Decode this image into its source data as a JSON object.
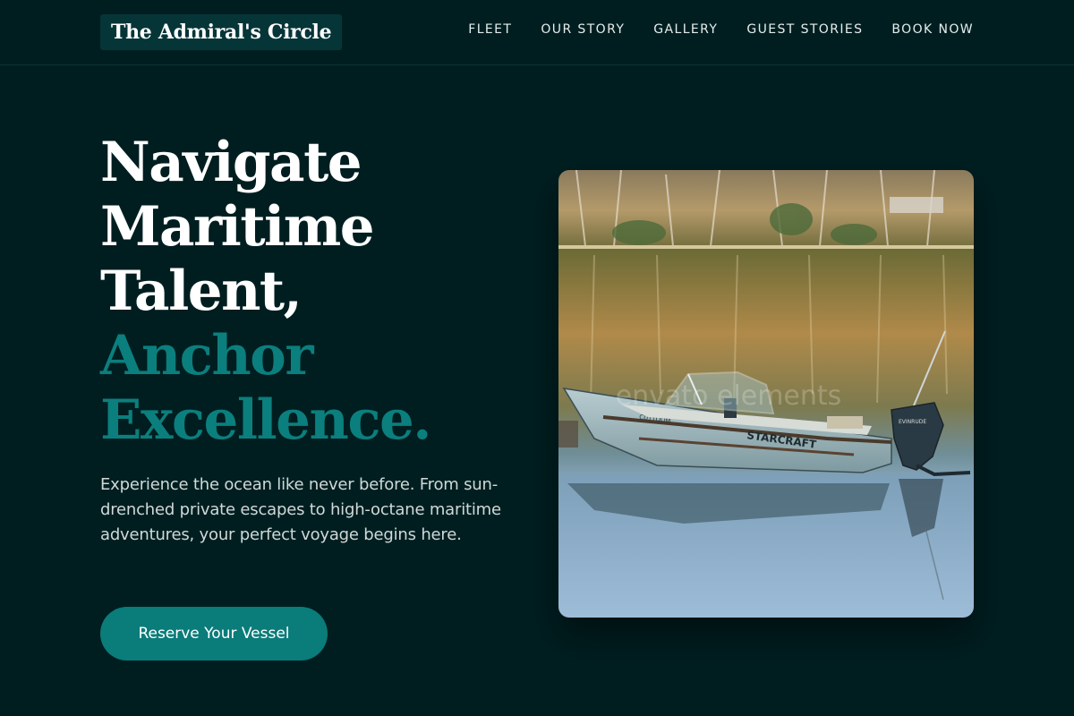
{
  "header": {
    "logo": "The Admiral's Circle",
    "nav": [
      {
        "label": "FLEET"
      },
      {
        "label": "OUR STORY"
      },
      {
        "label": "GALLERY"
      },
      {
        "label": "GUEST STORIES"
      },
      {
        "label": "BOOK NOW"
      }
    ]
  },
  "hero": {
    "title_lines": [
      "Navigate",
      "Maritime",
      "Talent,"
    ],
    "title_accent_lines": [
      "Anchor",
      "Excellence."
    ],
    "subtitle": "Experience the ocean like never before. From sun-drenched private escapes to high-octane maritime adventures, your perfect voyage begins here.",
    "cta_label": "Reserve Your Vessel"
  },
  "photo": {
    "boat_brand": "STARCRAFT",
    "watermark": "envato elements",
    "motor_label": "EVINRUDE",
    "hull_label": "CUTTOOM"
  },
  "colors": {
    "background": "#001e20",
    "accent": "#0b7f7d",
    "logo_bg": "#063538"
  }
}
